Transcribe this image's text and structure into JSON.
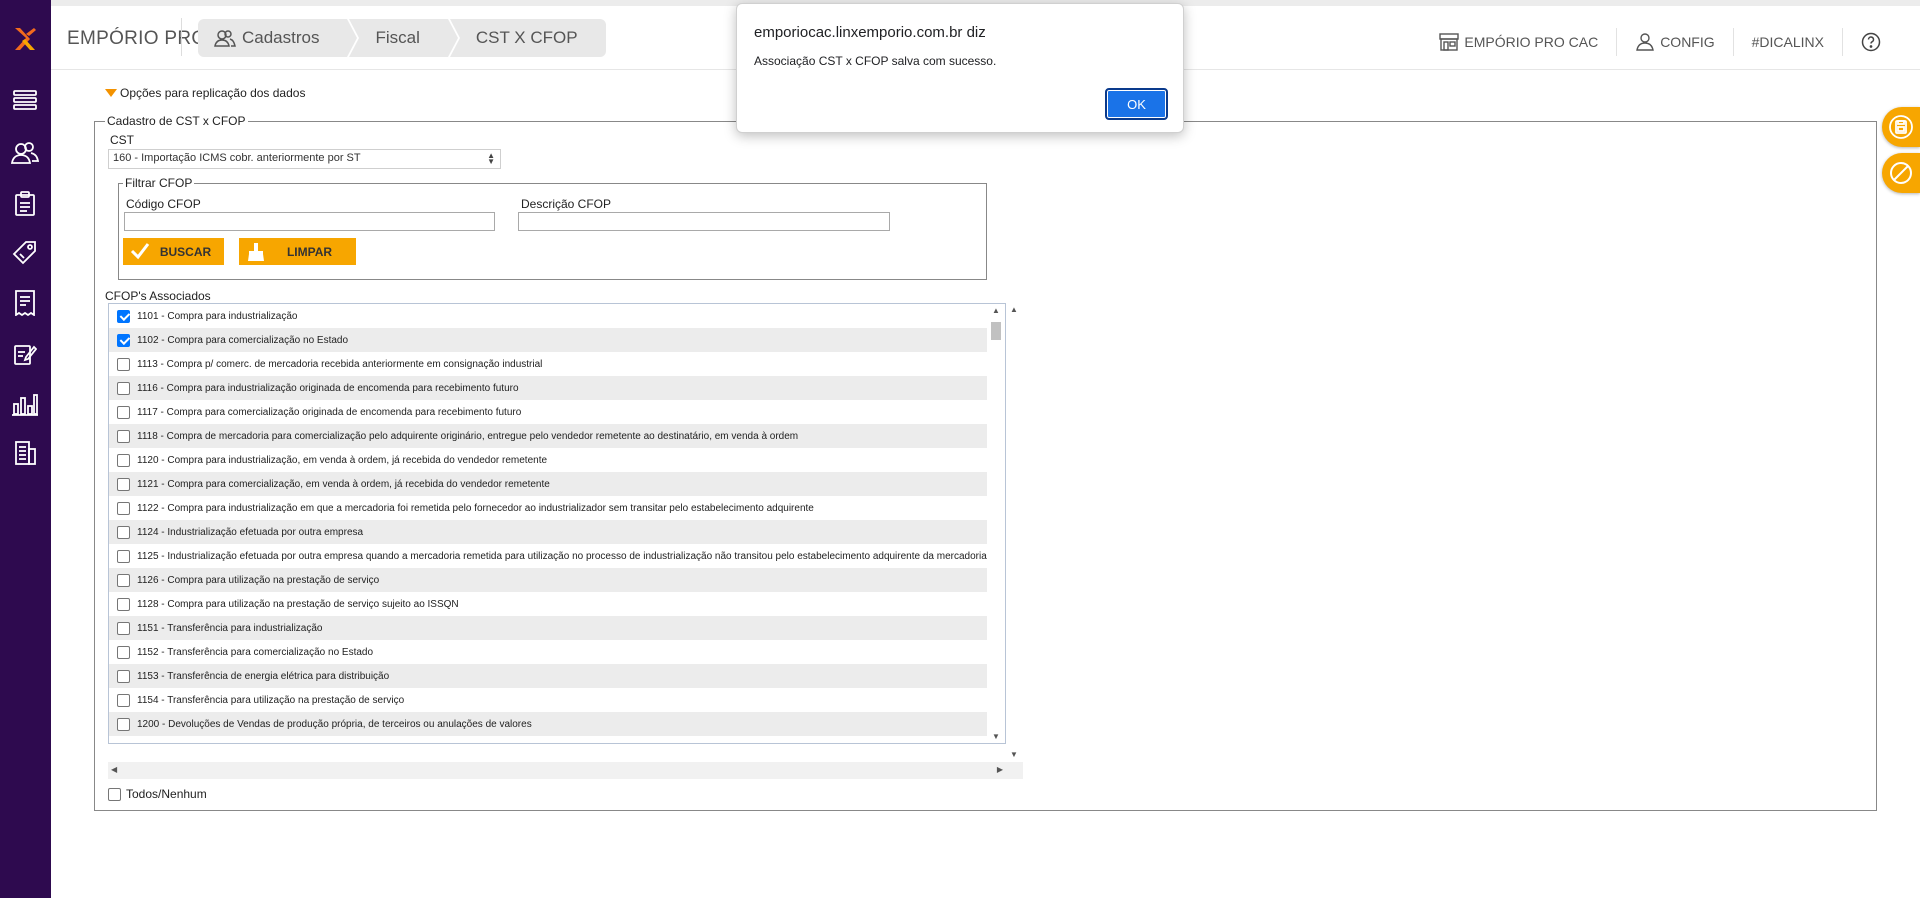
{
  "header": {
    "app_title": "EMPÓRIO PRO",
    "breadcrumb": [
      "Cadastros",
      "Fiscal",
      "CST X CFOP"
    ],
    "links": {
      "emporio_cac": "EMPÓRIO PRO CAC",
      "config": "CONFIG",
      "dicalinx": "#DICALINX"
    }
  },
  "sidebar": {
    "icons": [
      "logo-icon",
      "menu-stack-icon",
      "users-icon",
      "clipboard-icon",
      "tag-icon",
      "receipt-icon",
      "edit-document-icon",
      "bar-chart-icon",
      "building-icon"
    ]
  },
  "replication": {
    "label": "Opções para replicação dos dados"
  },
  "cadastro": {
    "legend": "Cadastro de CST x CFOP",
    "cst_label": "CST",
    "cst_value": "160 - Importação ICMS cobr. anteriormente por ST",
    "filter": {
      "legend": "Filtrar CFOP",
      "codigo_label": "Código CFOP",
      "codigo_value": "",
      "descricao_label": "Descrição CFOP",
      "descricao_value": "",
      "buscar_label": "BUSCAR",
      "limpar_label": "LIMPAR"
    },
    "associated_label": "CFOP's Associados",
    "cfops": [
      {
        "text": "1101 - Compra para industrialização",
        "checked": true
      },
      {
        "text": "1102 - Compra para comercialização no Estado",
        "checked": true
      },
      {
        "text": "1113 - Compra p/ comerc. de mercadoria recebida anteriormente em consignação industrial",
        "checked": false
      },
      {
        "text": "1116 - Compra para industrialização originada de encomenda para recebimento futuro",
        "checked": false
      },
      {
        "text": "1117 - Compra para comercialização originada de encomenda para recebimento futuro",
        "checked": false
      },
      {
        "text": "1118 - Compra de mercadoria para comercialização pelo adquirente originário, entregue pelo vendedor remetente ao destinatário, em venda à ordem",
        "checked": false
      },
      {
        "text": "1120 - Compra para industrialização, em venda à ordem, já recebida do vendedor remetente",
        "checked": false
      },
      {
        "text": "1121 - Compra para comercialização, em venda à ordem, já recebida do vendedor remetente",
        "checked": false
      },
      {
        "text": "1122 - Compra para industrialização em que a mercadoria foi remetida pelo fornecedor ao industrializador sem transitar pelo estabelecimento adquirente",
        "checked": false
      },
      {
        "text": "1124 - Industrialização efetuada por outra empresa",
        "checked": false
      },
      {
        "text": "1125 - Industrialização efetuada por outra empresa quando a mercadoria remetida para utilização no processo de industrialização não transitou pelo estabelecimento adquirente da mercadoria",
        "checked": false
      },
      {
        "text": "1126 - Compra para utilização na prestação de serviço",
        "checked": false
      },
      {
        "text": "1128 - Compra para utilização na prestação de serviço sujeito ao ISSQN",
        "checked": false
      },
      {
        "text": "1151 - Transferência para industrialização",
        "checked": false
      },
      {
        "text": "1152 - Transferência para comercialização no Estado",
        "checked": false
      },
      {
        "text": "1153 - Transferência de energia elétrica para distribuição",
        "checked": false
      },
      {
        "text": "1154 - Transferência para utilização na prestação de serviço",
        "checked": false
      },
      {
        "text": "1200 - Devoluções de Vendas de produção própria, de terceiros ou anulações de valores",
        "checked": false
      }
    ],
    "todos_label": "Todos/Nenhum"
  },
  "alert": {
    "origin": "emporiocac.linxemporio.com.br diz",
    "message": "Associação CST x CFOP salva com sucesso.",
    "ok_label": "OK"
  },
  "colors": {
    "sidebar": "#2e0a4f",
    "accent": "#f7a600",
    "checkbox_checked": "#0075ff",
    "dialog_button": "#1a73e8"
  }
}
